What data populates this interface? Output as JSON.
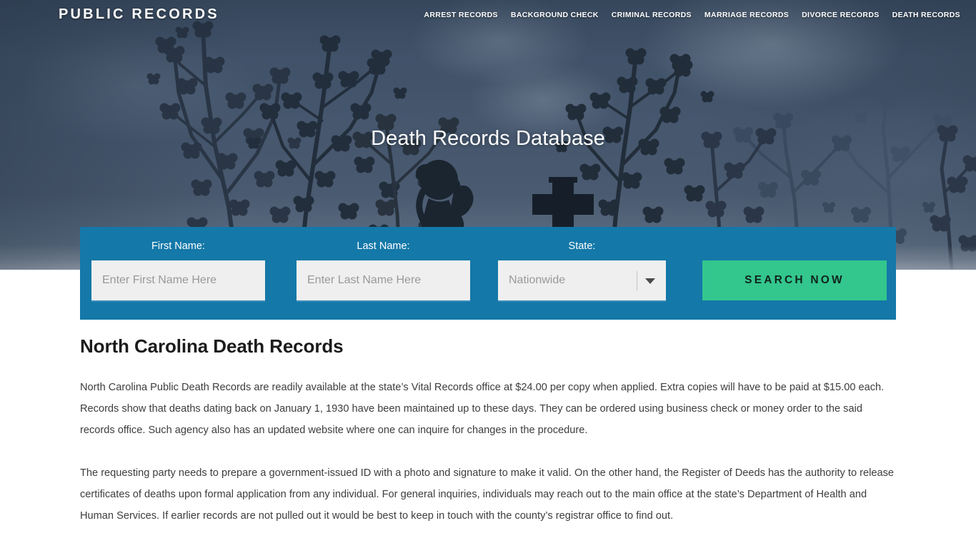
{
  "header": {
    "logo": "PUBLIC RECORDS",
    "nav": [
      {
        "label": "ARREST RECORDS"
      },
      {
        "label": "BACKGROUND CHECK"
      },
      {
        "label": "CRIMINAL RECORDS"
      },
      {
        "label": "MARRIAGE RECORDS"
      },
      {
        "label": "DIVORCE RECORDS"
      },
      {
        "label": "DEATH RECORDS"
      }
    ]
  },
  "hero": {
    "title": "Death Records Database",
    "background_description": "dark blue-gray overcast sky with silhouetted flowering branches, a praying child figure and a grave cross"
  },
  "search": {
    "first_name": {
      "label": "First Name:",
      "value": "",
      "placeholder": "Enter First Name Here"
    },
    "last_name": {
      "label": "Last Name:",
      "value": "",
      "placeholder": "Enter Last Name Here"
    },
    "state": {
      "label": "State:",
      "selected": "Nationwide",
      "placeholder": "Nationwide"
    },
    "submit_label": "SEARCH NOW"
  },
  "main": {
    "heading": "North Carolina Death Records",
    "paragraphs": [
      "North Carolina Public Death Records are readily available at the state’s Vital Records office at $24.00 per copy when applied. Extra copies will have to be paid at $15.00 each. Records show that deaths dating back on January 1, 1930 have been maintained up to these days. They can be ordered using business check or money order to the said records office. Such agency also has an updated website where one can inquire for changes in the procedure.",
      "The requesting party needs to prepare a government-issued ID with a photo and signature to make it valid. On the other hand, the Register of Deeds has the authority to release certificates of deaths upon formal application from any individual. For general inquiries, individuals may reach out to the main office at the state’s Department of Health and Human Services. If earlier records are not pulled out it would be best to keep in touch with the county’s registrar office to find out."
    ]
  },
  "colors": {
    "panel_blue": "#1478a8",
    "button_green": "#33c68d",
    "hero_sky": "#46576e",
    "input_bg": "#efefef"
  }
}
